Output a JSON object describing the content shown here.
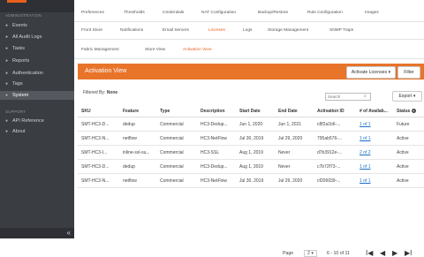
{
  "sidebar": {
    "section1": "ADMINISTRATION",
    "items": [
      {
        "icon": "events-icon",
        "glyph": "●",
        "label": "Events"
      },
      {
        "icon": "audit-icon",
        "glyph": "●",
        "label": "All Audit Logs"
      },
      {
        "icon": "tasks-icon",
        "glyph": "●",
        "label": "Tasks"
      },
      {
        "icon": "reports-icon",
        "glyph": "●",
        "label": "Reports"
      },
      {
        "icon": "authentication-icon",
        "glyph": "●",
        "label": "Authentication"
      },
      {
        "icon": "tags-icon",
        "glyph": "●",
        "label": "Tags"
      },
      {
        "icon": "system-icon",
        "glyph": "●",
        "label": "System"
      }
    ],
    "section2": "SUPPORT",
    "support_items": [
      {
        "icon": "api-icon",
        "glyph": "●",
        "label": "API Reference"
      },
      {
        "icon": "about-icon",
        "glyph": "●",
        "label": "About"
      }
    ],
    "collapse": "«"
  },
  "tabs": {
    "row1": [
      "Preferences",
      "Thresholds",
      "Credentials",
      "NAT Configuration",
      "Backup/Restore",
      "Rule Configuration",
      "Images"
    ],
    "row2": [
      "Front Store",
      "Notifications",
      "Email Servers",
      "Licenses",
      "Logs",
      "Storage Management",
      "SNMP Traps"
    ],
    "row3": [
      "Fabric Management",
      "Store View",
      "Activation View"
    ]
  },
  "panel": {
    "title": "Activation View",
    "activate_label": "Activate Licenses ▾",
    "filter_label": "Filter",
    "filtered_by_prefix": "Filtered By:",
    "filtered_by_value": "None",
    "search_placeholder": "Search",
    "export_label": "Export ▾"
  },
  "table": {
    "headers": [
      "SKU",
      "Feature",
      "Type",
      "Description",
      "Start Date",
      "End Date",
      "Activation ID",
      "# of Availab...",
      "Status"
    ],
    "rows": [
      [
        "SMT-HC3-D...",
        "dedup",
        "Commercial",
        "HC3-Dedup...",
        "Jun 1, 2020",
        "Jun 1, 2021",
        "c8f2a1b6-...",
        "1 of 1",
        "Future"
      ],
      [
        "SMT-HC3-N...",
        "netflow",
        "Commercial",
        "HC3-NetFlow",
        "Jul 30, 2019",
        "Jul 29, 2020",
        "795ab576-...",
        "1 of 1",
        "Active"
      ],
      [
        "SMT-HC3-I...",
        "inline-ssl-su...",
        "Commercial",
        "HC3-SSL",
        "Aug 1, 2019",
        "Never",
        "d7b3912e-...",
        "2 of 2",
        "Active"
      ],
      [
        "SMT-HC3-D...",
        "dedup",
        "Commercial",
        "HC3-Dedup...",
        "Aug 1, 2019",
        "Never",
        "c7b72f73-...",
        "1 of 1",
        "Active"
      ],
      [
        "SMT-HC3-N...",
        "netflow",
        "Commercial",
        "HC3-NetFlow",
        "Jul 30, 2019",
        "Jul 29, 2020",
        "cf206939-...",
        "1 of 1",
        "Active"
      ]
    ]
  },
  "pager": {
    "page_label": "Page",
    "page_value": "2 ▾",
    "range": "6 - 10 of 11",
    "first": "I◀",
    "prev": "◀",
    "next": "▶",
    "last": "▶I"
  }
}
